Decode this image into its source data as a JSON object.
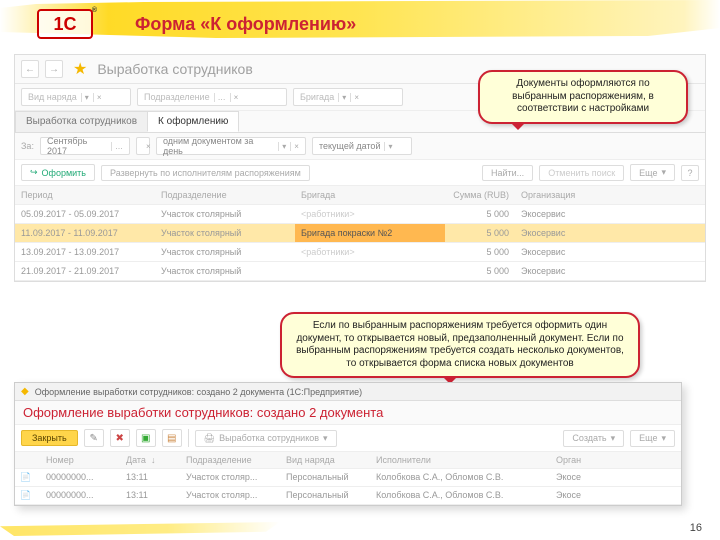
{
  "slide": {
    "logo_text": "1С",
    "title": "Форма «К оформлению»",
    "page_number": "16"
  },
  "app": {
    "page_title": "Выработка сотрудников",
    "filters": {
      "assignment_type": "Вид наряда",
      "department": "Подразделение",
      "brigade": "Бригада"
    },
    "tabs": {
      "tab1": "Выработка сотрудников",
      "tab2": "К оформлению"
    },
    "criteria": {
      "label_for": "За:",
      "period": "Сентябрь 2017",
      "mode": "одним документом за день",
      "date_mode": "текущей датой"
    },
    "toolbar": {
      "create": "Оформить",
      "expand": "Развернуть по исполнителям распоряжениям",
      "find": "Найти...",
      "cancel_search": "Отменить поиск",
      "more": "Еще",
      "help": "?"
    },
    "columns": {
      "period": "Период",
      "department": "Подразделение",
      "brigade": "Бригада",
      "sum": "Сумма (RUB)",
      "org": "Организация"
    },
    "rows": [
      {
        "period": "05.09.2017 - 05.09.2017",
        "dept": "Участок столярный",
        "brigade": "<работники>",
        "sum": "5 000",
        "org": "Экосервис"
      },
      {
        "period": "11.09.2017 - 11.09.2017",
        "dept": "Участок столярный",
        "brigade": "Бригада покраски №2",
        "sum": "5 000",
        "org": "Экосервис"
      },
      {
        "period": "13.09.2017 - 13.09.2017",
        "dept": "Участок столярный",
        "brigade": "<работники>",
        "sum": "5 000",
        "org": "Экосервис"
      },
      {
        "period": "21.09.2017 - 21.09.2017",
        "dept": "Участок столярный",
        "brigade": "",
        "sum": "5 000",
        "org": "Экосервис"
      }
    ]
  },
  "callouts": {
    "c1": "Документы оформляются по выбранным распоряжениям, в соответствии с настройками",
    "c2": "Если по выбранным распоряжениям требуется оформить один документ, то открывается новый, предзаполненный документ. Если по выбранным распоряжениям требуется создать несколько документов, то открывается форма списка новых документов"
  },
  "dialog": {
    "window_title": "Оформление выработки сотрудников: создано 2 документа  (1С:Предприятие)",
    "heading": "Оформление выработки сотрудников: создано 2 документа",
    "close": "Закрыть",
    "produce": "Выработка сотрудников",
    "create": "Создать",
    "more": "Еще",
    "columns": {
      "num": "Номер",
      "date": "Дата",
      "dept": "Подразделение",
      "type": "Вид наряда",
      "performers": "Исполнители",
      "org": "Орган"
    },
    "rows": [
      {
        "num": "00000000...",
        "date": "13:11",
        "dept": "Участок столяр...",
        "type": "Персональный",
        "performers": "Колобкова С.А., Обломов С.В.",
        "org": "Экосе"
      },
      {
        "num": "00000000...",
        "date": "13:11",
        "dept": "Участок столяр...",
        "type": "Персональный",
        "performers": "Колобкова С.А., Обломов С.В.",
        "org": "Экосе"
      }
    ]
  }
}
